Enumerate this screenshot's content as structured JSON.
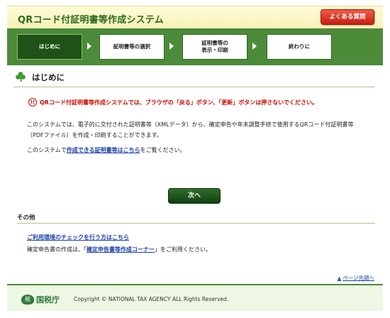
{
  "header": {
    "title": "QRコード付証明書等作成システム",
    "faq_label": "よくある質問"
  },
  "steps": [
    {
      "label": "はじめに",
      "active": true
    },
    {
      "label": "証明書等の選択",
      "active": false
    },
    {
      "label": "証明書等の\n表示・印刷",
      "active": false
    },
    {
      "label": "終わりに",
      "active": false
    }
  ],
  "section": {
    "title": "はじめに",
    "warning": "QRコード付証明書等作成システムでは、ブラウザの「戻る」ボタン、「更新」ボタンは押さないでください。",
    "para1": "このシステムでは、電子的に交付された証明書等（XMLデータ）から、確定申告や年末調整手続で使用するQRコード付証明書等（PDFファイル）を作成・印刷することができます。",
    "para2_prefix": "このシステムで",
    "para2_link": "作成できる証明書等はこちら",
    "para2_suffix": "をご覧ください。",
    "next_label": "次へ"
  },
  "other": {
    "title": "その他",
    "env_link": "ご利用環境のチェックを行う方はこちら",
    "tax_prefix": "確定申告書の作成は、「",
    "tax_link": "確定申告書等作成コーナー",
    "tax_suffix": "」をご利用ください。"
  },
  "top_link": "ページ先頭へ",
  "footer": {
    "logo_mark": "税",
    "logo_text": "国税庁",
    "copyright": "Copyright © NATIONAL TAX AGENCY ALL Rights Reserved."
  },
  "colors": {
    "accent_green": "#4b8b39",
    "warning_red": "#cc0a00",
    "link_blue": "#1a3fa8"
  }
}
